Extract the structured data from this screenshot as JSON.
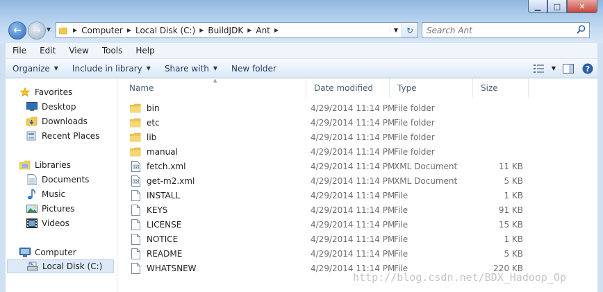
{
  "window": {
    "minimize_glyph": "▁",
    "maximize_glyph": "□",
    "close_glyph": "✕"
  },
  "address": {
    "crumbs": [
      "Computer",
      "Local Disk (C:)",
      "BuildJDK",
      "Ant"
    ]
  },
  "search": {
    "placeholder": "Search Ant"
  },
  "menu": [
    "File",
    "Edit",
    "View",
    "Tools",
    "Help"
  ],
  "commands": {
    "organize": "Organize",
    "include": "Include in library",
    "share": "Share with",
    "new_folder": "New folder"
  },
  "nav": {
    "favorites": "Favorites",
    "desktop": "Desktop",
    "downloads": "Downloads",
    "recent": "Recent Places",
    "libraries": "Libraries",
    "documents": "Documents",
    "music": "Music",
    "pictures": "Pictures",
    "videos": "Videos",
    "computer": "Computer",
    "local_disk": "Local Disk (C:)"
  },
  "columns": {
    "name": "Name",
    "date": "Date modified",
    "type": "Type",
    "size": "Size"
  },
  "files": [
    {
      "name": "bin",
      "date": "4/29/2014 11:14 PM",
      "type": "File folder",
      "size": "",
      "kind": "folder-icon"
    },
    {
      "name": "etc",
      "date": "4/29/2014 11:14 PM",
      "type": "File folder",
      "size": "",
      "kind": "folder-icon"
    },
    {
      "name": "lib",
      "date": "4/29/2014 11:14 PM",
      "type": "File folder",
      "size": "",
      "kind": "folder-icon"
    },
    {
      "name": "manual",
      "date": "4/29/2014 11:14 PM",
      "type": "File folder",
      "size": "",
      "kind": "folder-icon"
    },
    {
      "name": "fetch.xml",
      "date": "4/29/2014 11:14 PM",
      "type": "XML Document",
      "size": "11 KB",
      "kind": "xml-file-icon"
    },
    {
      "name": "get-m2.xml",
      "date": "4/29/2014 11:14 PM",
      "type": "XML Document",
      "size": "5 KB",
      "kind": "xml-file-icon"
    },
    {
      "name": "INSTALL",
      "date": "4/29/2014 11:14 PM",
      "type": "File",
      "size": "1 KB",
      "kind": "file-icon"
    },
    {
      "name": "KEYS",
      "date": "4/29/2014 11:14 PM",
      "type": "File",
      "size": "91 KB",
      "kind": "file-icon"
    },
    {
      "name": "LICENSE",
      "date": "4/29/2014 11:14 PM",
      "type": "File",
      "size": "15 KB",
      "kind": "file-icon"
    },
    {
      "name": "NOTICE",
      "date": "4/29/2014 11:14 PM",
      "type": "File",
      "size": "1 KB",
      "kind": "file-icon"
    },
    {
      "name": "README",
      "date": "4/29/2014 11:14 PM",
      "type": "File",
      "size": "5 KB",
      "kind": "file-icon"
    },
    {
      "name": "WHATSNEW",
      "date": "4/29/2014 11:14 PM",
      "type": "File",
      "size": "220 KB",
      "kind": "file-icon"
    }
  ],
  "watermark": "http://blog.csdn.net/BDX_Hadoop_Op",
  "colors": {
    "accent": "#2f66b6",
    "folder": "#f2c94c",
    "selection": "#dde9f7"
  }
}
